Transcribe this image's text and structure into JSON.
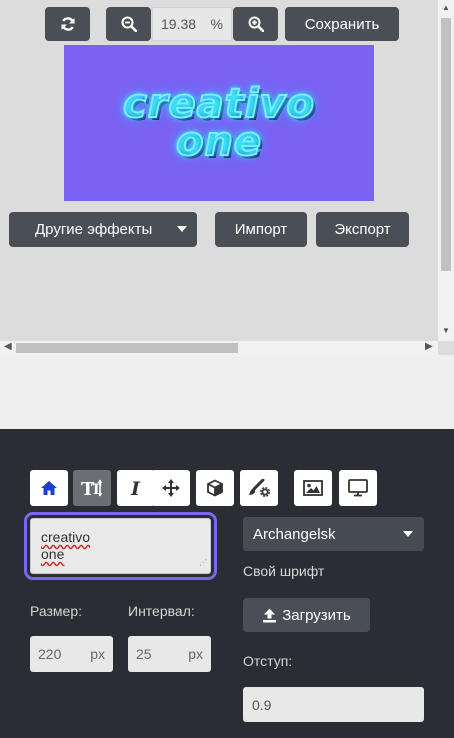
{
  "toolbar": {
    "zoom_value": "19.38",
    "zoom_unit": "%",
    "save_label": "Сохранить"
  },
  "canvas": {
    "background": "#7b62f3",
    "line1": "creativo",
    "line2": "one"
  },
  "actions": {
    "effects_label": "Другие эффекты",
    "import_label": "Импорт",
    "export_label": "Экспорт"
  },
  "tools": [
    {
      "icon": "home-icon",
      "active": false
    },
    {
      "icon": "text-size-icon",
      "active": true
    },
    {
      "icon": "italic-icon",
      "active": false
    },
    {
      "icon": "move-icon",
      "active": false
    },
    {
      "icon": "cube-icon",
      "active": false
    },
    {
      "icon": "paint-brush-icon",
      "active": false
    },
    {
      "icon": "image-icon",
      "active": false
    },
    {
      "icon": "monitor-icon",
      "active": false
    }
  ],
  "text_input": {
    "line1": "creativo",
    "line2": "one"
  },
  "font": {
    "selected": "Archangelsk",
    "custom_font_label": "Свой шрифт",
    "upload_label": "Загрузить"
  },
  "size": {
    "label": "Размер:",
    "value": "220",
    "unit": "px"
  },
  "interval": {
    "label": "Интервал:",
    "value": "25",
    "unit": "px"
  },
  "offset": {
    "label": "Отступ:",
    "value": "0.9"
  },
  "colors": {
    "accent": "#7b68ee",
    "panel": "#2a2d33",
    "button": "#4a4f55",
    "neon": "#6ff3ff"
  }
}
